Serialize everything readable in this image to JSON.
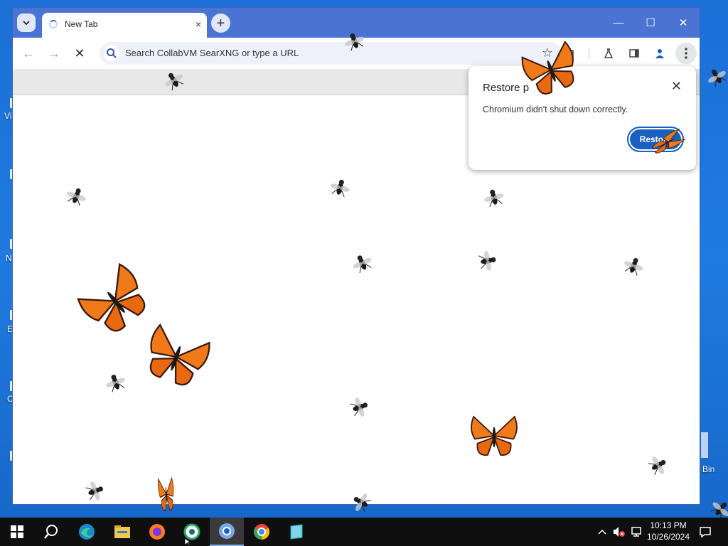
{
  "desktop": {
    "labels": [
      "Vis",
      "N",
      "E",
      "C",
      "Bin"
    ]
  },
  "browser": {
    "tab_title": "New Tab",
    "tab_close": "×",
    "new_tab_symbol": "+",
    "minimize": "—",
    "maximize": "☐",
    "close": "✕",
    "omnibox_placeholder": "Search CollabVM SearXNG or type a URL",
    "back": "←",
    "forward": "→",
    "stop": "✕"
  },
  "restore_popup": {
    "title": "Restore p",
    "message": "Chromium didn't shut down correctly.",
    "button_label": "Restore",
    "close": "✕"
  },
  "taskbar": {
    "time": "10:13 PM",
    "date": "10/26/2024",
    "items": [
      "start",
      "search",
      "edge",
      "file-explorer",
      "firefox",
      "app-6",
      "chromium",
      "chrome",
      "app-9"
    ]
  },
  "colors": {
    "desktop": "#1f7be0",
    "tabstrip": "#4a73d3",
    "accent": "#1a5fc2",
    "butterfly": "#f07a1a"
  }
}
